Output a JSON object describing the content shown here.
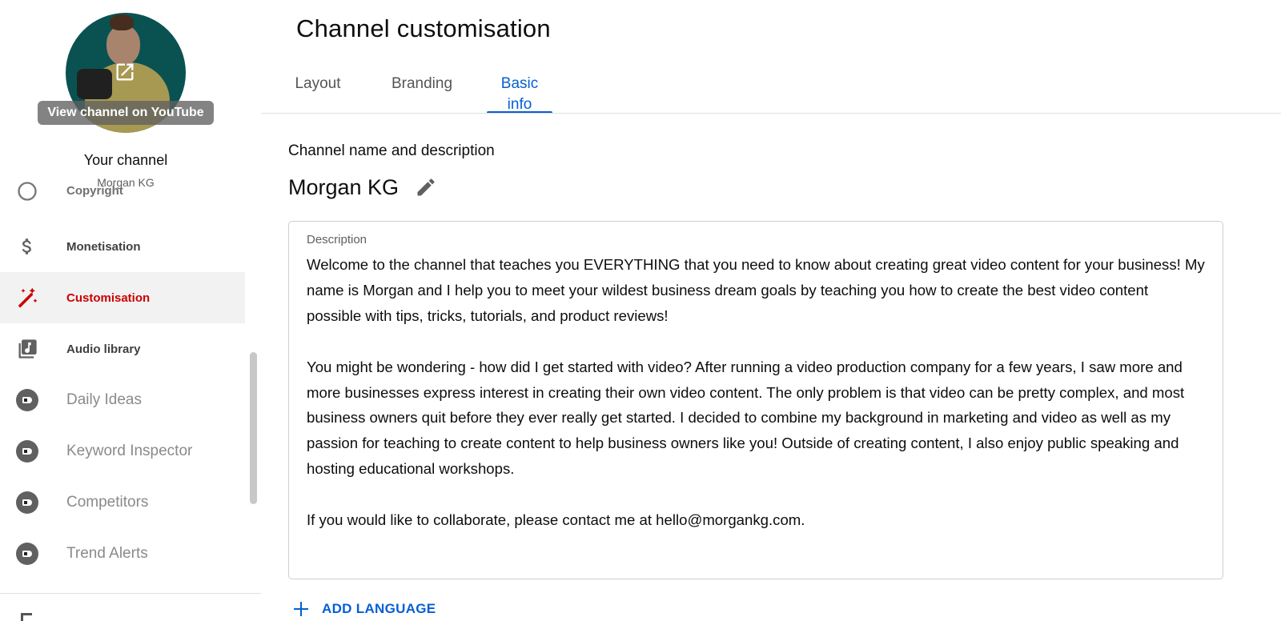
{
  "sidebar": {
    "view_channel_label": "View channel on YouTube",
    "your_channel_label": "Your channel",
    "channel_handle": "Morgan KG",
    "items": [
      {
        "label": "Copyright",
        "icon": "copyright-icon",
        "state": "partially-visible"
      },
      {
        "label": "Monetisation",
        "icon": "dollar-icon",
        "state": "normal"
      },
      {
        "label": "Customisation",
        "icon": "magic-wand-icon",
        "state": "active"
      },
      {
        "label": "Audio library",
        "icon": "audio-library-icon",
        "state": "normal"
      },
      {
        "label": "Daily Ideas",
        "icon": "vidiq-pin-icon",
        "state": "extension"
      },
      {
        "label": "Keyword Inspector",
        "icon": "vidiq-pin-icon",
        "state": "extension"
      },
      {
        "label": "Competitors",
        "icon": "vidiq-pin-icon",
        "state": "extension"
      },
      {
        "label": "Trend Alerts",
        "icon": "vidiq-pin-icon",
        "state": "extension"
      }
    ]
  },
  "main": {
    "page_title": "Channel customisation",
    "tabs": [
      {
        "label": "Layout",
        "active": false
      },
      {
        "label": "Branding",
        "active": false
      },
      {
        "label": "Basic info",
        "active": true
      }
    ],
    "section_title": "Channel name and description",
    "channel_name": "Morgan KG",
    "description": {
      "label": "Description",
      "paragraphs": [
        "Welcome to the channel that teaches you EVERYTHING that you need to know about creating great video content for your business! My name is Morgan and I help you to meet your wildest business dream goals by teaching you how to create the best video content possible with tips, tricks, tutorials, and product reviews!",
        "You might be wondering - how did I get started with video? After running a video production company for a few years, I saw more and more businesses express interest in creating their own video content. The only problem is that video can be pretty complex, and most business owners quit before they ever really get started. I decided to combine my background in marketing and video as well as my passion for teaching to create content to help business owners like you! Outside of creating content, I also enjoy public speaking and hosting educational workshops.",
        "If you would like to collaborate, please contact me at hello@morgankg.com."
      ]
    },
    "add_language_label": "ADD LANGUAGE"
  },
  "colors": {
    "accent_blue": "#065fd4",
    "active_red": "#cc0000",
    "avatar_bg": "#0d6a6a"
  }
}
